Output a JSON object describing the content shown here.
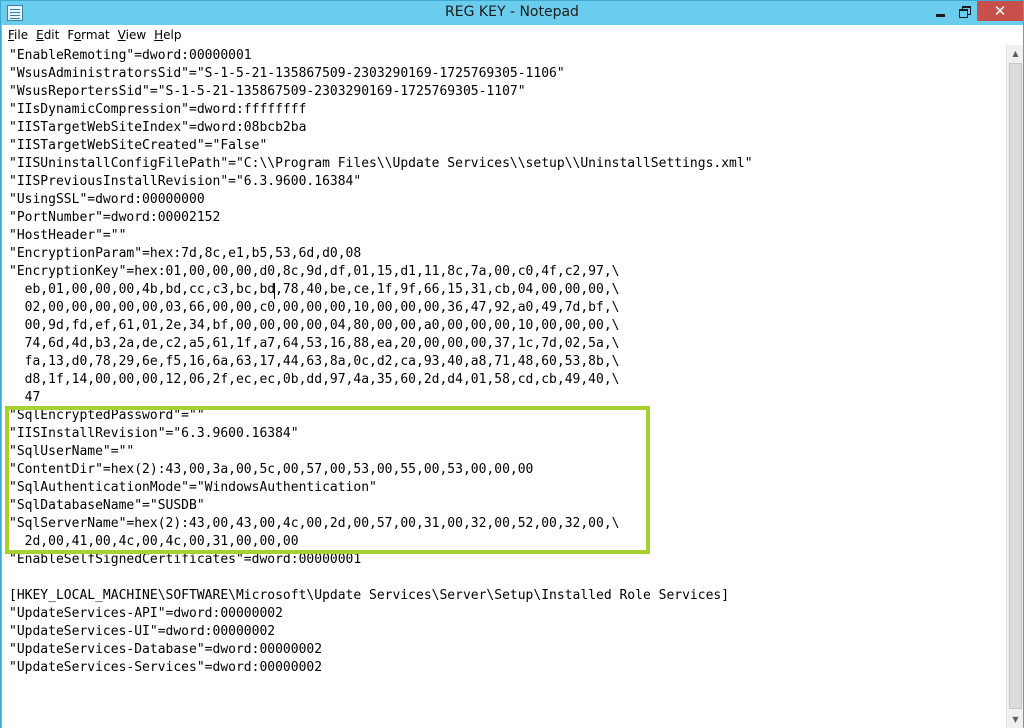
{
  "window": {
    "title": "REG KEY - Notepad",
    "icon": "notepad-icon",
    "controls": {
      "minimize": "minimize-icon",
      "maximize": "restore-icon",
      "close": "✕"
    }
  },
  "menu": [
    {
      "accel": "F",
      "rest": "ile"
    },
    {
      "accel": "E",
      "rest": "dit"
    },
    {
      "pre": "F",
      "accel": "o",
      "rest": "rmat"
    },
    {
      "accel": "V",
      "rest": "iew"
    },
    {
      "accel": "H",
      "rest": "elp"
    }
  ],
  "editor": {
    "lines": [
      "\"EnableRemoting\"=dword:00000001",
      "\"WsusAdministratorsSid\"=\"S-1-5-21-135867509-2303290169-1725769305-1106\"",
      "\"WsusReportersSid\"=\"S-1-5-21-135867509-2303290169-1725769305-1107\"",
      "\"IIsDynamicCompression\"=dword:ffffffff",
      "\"IISTargetWebSiteIndex\"=dword:08bcb2ba",
      "\"IISTargetWebSiteCreated\"=\"False\"",
      "\"IISUninstallConfigFilePath\"=\"C:\\\\Program Files\\\\Update Services\\\\setup\\\\UninstallSettings.xml\"",
      "\"IISPreviousInstallRevision\"=\"6.3.9600.16384\"",
      "\"UsingSSL\"=dword:00000000",
      "\"PortNumber\"=dword:00002152",
      "\"HostHeader\"=\"\"",
      "\"EncryptionParam\"=hex:7d,8c,e1,b5,53,6d,d0,08",
      "\"EncryptionKey\"=hex:01,00,00,00,d0,8c,9d,df,01,15,d1,11,8c,7a,00,c0,4f,c2,97,\\",
      "  eb,01,00,00,00,4b,bd,cc,c3,bc,bd,78,40,be,ce,1f,9f,66,15,31,cb,04,00,00,00,\\",
      "  02,00,00,00,00,00,03,66,00,00,c0,00,00,00,10,00,00,00,36,47,92,a0,49,7d,bf,\\",
      "  00,9d,fd,ef,61,01,2e,34,bf,00,00,00,00,04,80,00,00,a0,00,00,00,10,00,00,00,\\",
      "  74,6d,4d,b3,2a,de,c2,a5,61,1f,a7,64,53,16,88,ea,20,00,00,00,37,1c,7d,02,5a,\\",
      "  fa,13,d0,78,29,6e,f5,16,6a,63,17,44,63,8a,0c,d2,ca,93,40,a8,71,48,60,53,8b,\\",
      "  d8,1f,14,00,00,00,12,06,2f,ec,ec,0b,dd,97,4a,35,60,2d,d4,01,58,cd,cb,49,40,\\",
      "  47",
      "\"SqlEncryptedPassword\"=\"\"",
      "\"IISInstallRevision\"=\"6.3.9600.16384\"",
      "\"SqlUserName\"=\"\"",
      "\"ContentDir\"=hex(2):43,00,3a,00,5c,00,57,00,53,00,55,00,53,00,00,00",
      "\"SqlAuthenticationMode\"=\"WindowsAuthentication\"",
      "\"SqlDatabaseName\"=\"SUSDB\"",
      "\"SqlServerName\"=hex(2):43,00,43,00,4c,00,2d,00,57,00,31,00,32,00,52,00,32,00,\\",
      "  2d,00,41,00,4c,00,4c,00,31,00,00,00",
      "\"EnableSelfSignedCertificates\"=dword:00000001",
      "",
      "[HKEY_LOCAL_MACHINE\\SOFTWARE\\Microsoft\\Update Services\\Server\\Setup\\Installed Role Services]",
      "\"UpdateServices-API\"=dword:00000002",
      "\"UpdateServices-UI\"=dword:00000002",
      "\"UpdateServices-Database\"=dword:00000002",
      "\"UpdateServices-Services\"=dword:00000002"
    ],
    "highlight_color": "#a6d22e"
  },
  "scrollbar": {
    "up": "▲",
    "down": "▼"
  }
}
